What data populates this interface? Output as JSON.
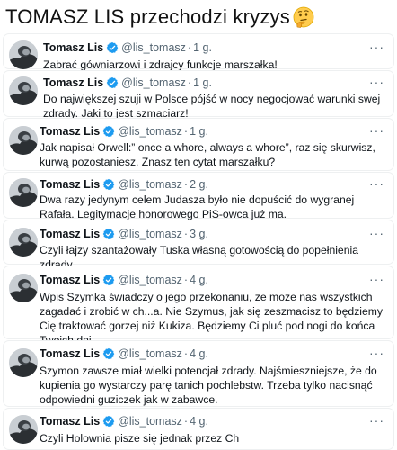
{
  "headline": "TOMASZ LIS przechodzi kryzys",
  "headline_emoji": "thinking-face-icon",
  "colors": {
    "verified": "#1d9bf0",
    "secondary_text": "#536471",
    "primary_text": "#0f1419"
  },
  "tweets": [
    {
      "name": "Tomasz Lis",
      "handle": "@lis_tomasz",
      "dot": "·",
      "time": "1 g.",
      "more": "···",
      "text": "Zabrać gówniarzowi i zdrajcy funkcje marszałka!"
    },
    {
      "name": "Tomasz Lis",
      "handle": "@lis_tomasz",
      "dot": "·",
      "time": "1 g.",
      "more": "···",
      "text": "Do największej szuji w Polsce pójść w nocy negocjować warunki swej zdrady. Jaki to jest szmaciarz!"
    },
    {
      "name": "Tomasz Lis",
      "handle": "@lis_tomasz",
      "dot": "·",
      "time": "1 g.",
      "more": "···",
      "text": "Jak napisał Orwell:” once a whore, always a whore”,  raz się skurwisz, kurwą pozostaniesz. Znasz ten cytat marszałku?"
    },
    {
      "name": "Tomasz Lis",
      "handle": "@lis_tomasz",
      "dot": "·",
      "time": "2 g.",
      "more": "···",
      "text": "Dwa razy jedynym celem Judasza było nie dopuścić do wygranej Rafała. Legitymacje honorowego PiS-owca już ma."
    },
    {
      "name": "Tomasz Lis",
      "handle": "@lis_tomasz",
      "dot": "·",
      "time": "3 g.",
      "more": "···",
      "text": "Czyli łajzy szantażowały Tuska własną gotowością do popełnienia zdrady."
    },
    {
      "name": "Tomasz Lis",
      "handle": "@lis_tomasz",
      "dot": "·",
      "time": "4 g.",
      "more": "···",
      "text": "Wpis Szymka świadczy o jego przekonaniu, że może nas wszystkich zagadać i zrobić w ch...a. Nie Szymus, jak się zeszmacisz to będziemy Cię traktować  gorzej niż Kukiza. Będziemy Ci pluć pod nogi do końca Twoich dni."
    },
    {
      "name": "Tomasz Lis",
      "handle": "@lis_tomasz",
      "dot": "·",
      "time": "4 g.",
      "more": "···",
      "text": "Szymon zawsze miał wielki potencjał zdrady. Najśmieszniejsze, że do kupienia go wystarczy parę tanich pochlebstw. Trzeba tylko nacisnąć odpowiedni guziczek jak w zabawce."
    },
    {
      "name": "Tomasz Lis",
      "handle": "@lis_tomasz",
      "dot": "·",
      "time": "4 g.",
      "more": "···",
      "text": "Czyli Holownia pisze się jednak przez Ch"
    }
  ]
}
